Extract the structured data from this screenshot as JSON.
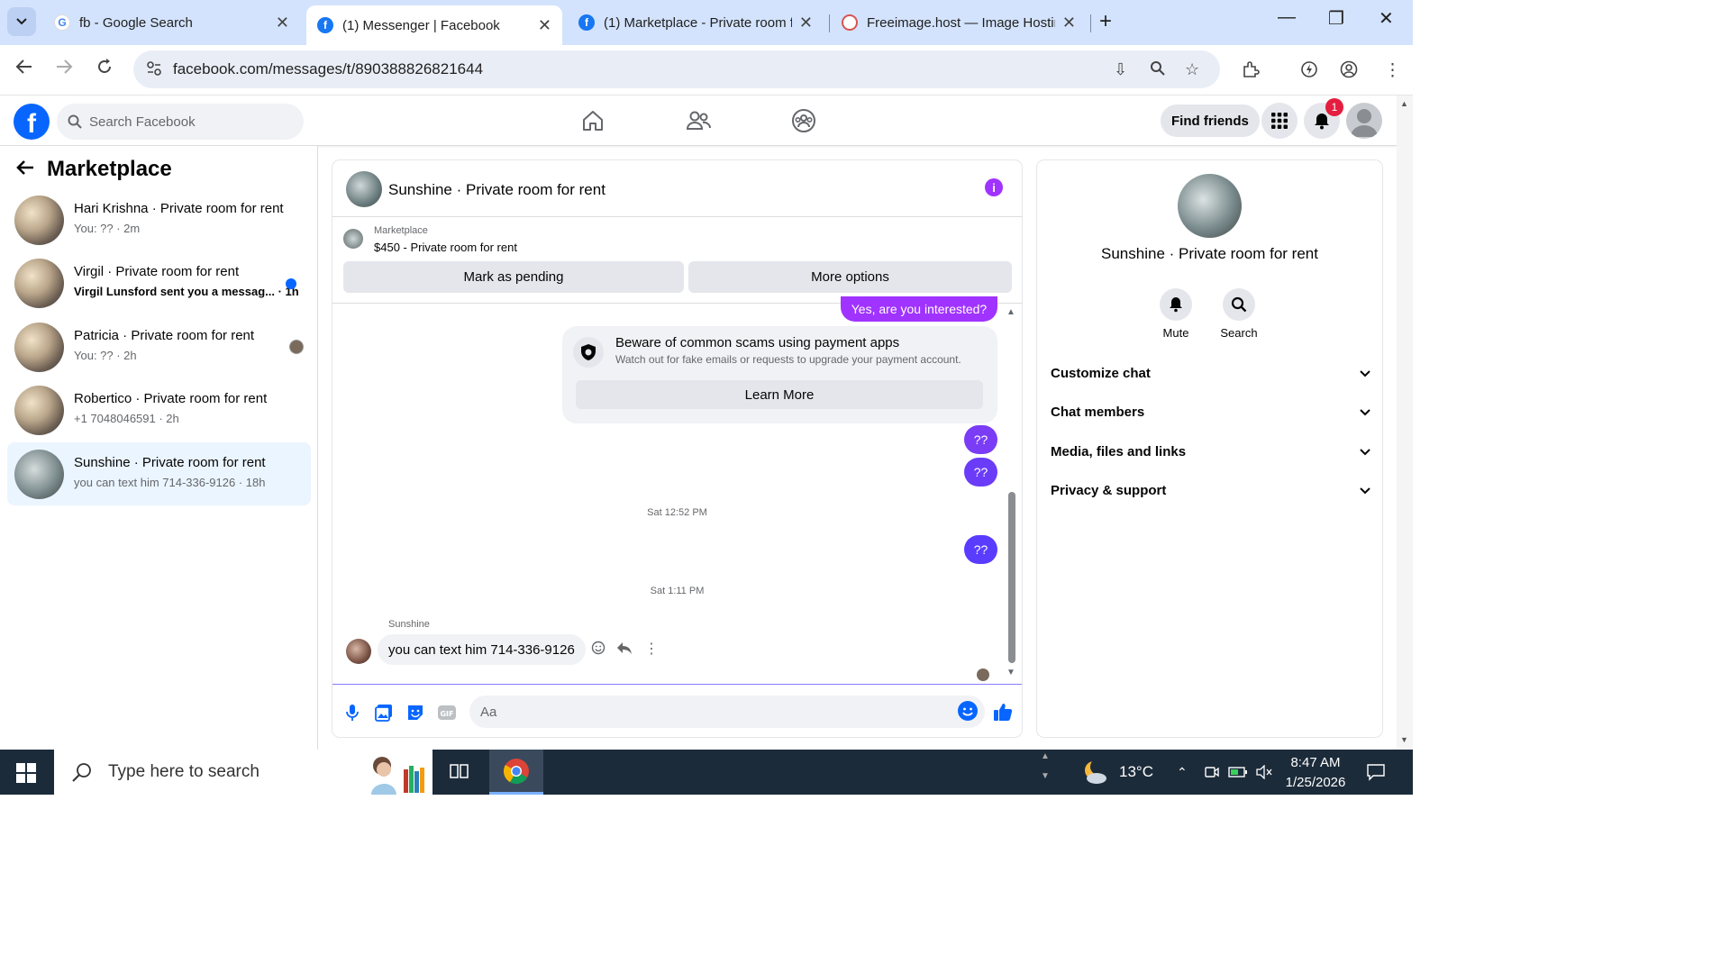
{
  "browser": {
    "tabs": [
      {
        "title": "fb - Google Search",
        "active": false
      },
      {
        "title": "(1) Messenger | Facebook",
        "active": true
      },
      {
        "title": "(1) Marketplace - Private room f",
        "active": false
      },
      {
        "title": "Freeimage.host — Image Hostir",
        "active": false
      }
    ],
    "new_tab": "+",
    "url": "facebook.com/messages/t/890388826821644",
    "window_controls": {
      "minimize": "—",
      "restore": "❐",
      "close": "✕"
    }
  },
  "fb_header": {
    "logo": "f",
    "search_placeholder": "Search Facebook",
    "nav_icons": [
      "home-icon",
      "friends-icon",
      "groups-icon"
    ],
    "find_friends": "Find friends",
    "notification_count": "1"
  },
  "sidebar": {
    "title": "Marketplace",
    "conversations": [
      {
        "name": "Hari Krishna · Private room for rent",
        "preview": "You: ?? · 2m",
        "unread": false,
        "selected": false
      },
      {
        "name": "Virgil · Private room for rent",
        "preview": "Virgil Lunsford sent you a messag... · 1h",
        "unread": true,
        "selected": false
      },
      {
        "name": "Patricia · Private room for rent",
        "preview": "You: ?? · 2h",
        "unread": false,
        "selected": false
      },
      {
        "name": "Robertico · Private room for rent",
        "preview": "+1 7048046591 · 2h",
        "unread": false,
        "selected": false
      },
      {
        "name": "Sunshine · Private room for rent",
        "preview": "you can text him 714-336-9126 · 18h",
        "unread": false,
        "selected": true
      }
    ]
  },
  "chat": {
    "title": "Sunshine · Private room for rent",
    "listing": {
      "label": "Marketplace",
      "price_title": "$450 - Private room for rent",
      "mark_pending": "Mark as pending",
      "more_options": "More options"
    },
    "messages": {
      "top_outgoing": "Yes, are you interested?",
      "scam_title": "Beware of common scams using payment apps",
      "scam_sub": "Watch out for fake emails or requests to upgrade your payment account.",
      "learn_more": "Learn More",
      "out_1": "??",
      "out_2": "??",
      "time_1": "Sat 12:52 PM",
      "out_3": "??",
      "time_2": "Sat 1:11 PM",
      "sender": "Sunshine",
      "incoming": "you can text him 714-336-9126"
    },
    "composer_placeholder": "Aa"
  },
  "details": {
    "name": "Sunshine · Private room for rent",
    "actions": [
      {
        "label": "Mute"
      },
      {
        "label": "Search"
      }
    ],
    "sections": [
      "Customize chat",
      "Chat members",
      "Media, files and links",
      "Privacy & support"
    ]
  },
  "taskbar": {
    "search_placeholder": "Type here to search",
    "temperature": "13°C",
    "time": "8:47 AM",
    "date": "1/25/2026"
  },
  "colors": {
    "fb_blue": "#0866ff",
    "messenger_purple": "#a033ff",
    "chrome_tabbar": "#d3e3fd"
  }
}
